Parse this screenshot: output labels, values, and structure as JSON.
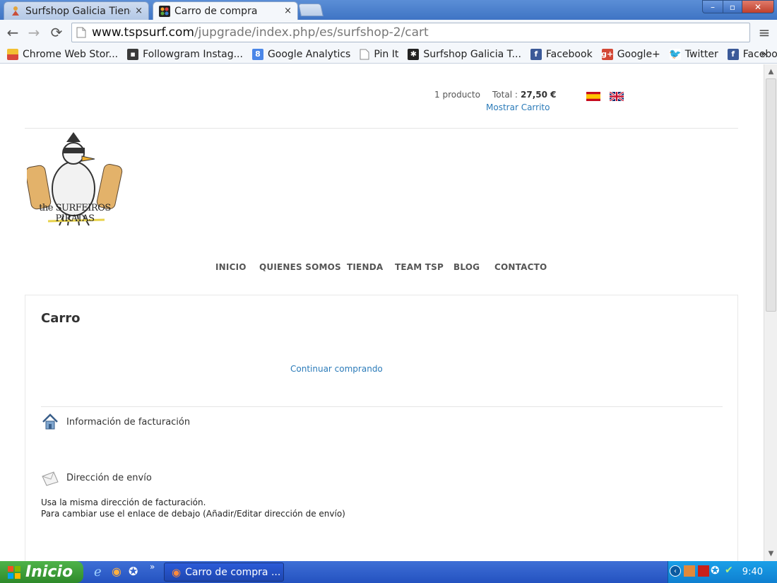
{
  "browser": {
    "tabs": [
      {
        "label": "Surfshop Galicia Tienda",
        "close": "×",
        "active": false
      },
      {
        "label": "Carro de compra",
        "close": "×",
        "active": true
      }
    ],
    "window_controls": {
      "minimize": "–",
      "maximize": "▫",
      "close": "✕"
    },
    "url_host": "www.tspsurf.com",
    "url_path": "/jupgrade/index.php/es/surfshop-2/cart",
    "bookmarks": [
      {
        "label": "Chrome Web Stor...",
        "icon": "chrome-store-icon"
      },
      {
        "label": "Followgram Instag...",
        "icon": "followgram-icon"
      },
      {
        "label": "Google Analytics",
        "icon": "google-analytics-icon"
      },
      {
        "label": "Pin It",
        "icon": "page-icon"
      },
      {
        "label": "Surfshop Galicia T...",
        "icon": "joomla-icon"
      },
      {
        "label": "Facebook",
        "icon": "facebook-icon"
      },
      {
        "label": "Google+",
        "icon": "googleplus-icon"
      },
      {
        "label": "Twitter",
        "icon": "twitter-icon"
      },
      {
        "label": "Facebook",
        "icon": "facebook-icon"
      }
    ],
    "bookmarks_overflow": "»"
  },
  "page": {
    "cart": {
      "products": "1 producto",
      "total_label": "Total :",
      "total_value": "27,50 €",
      "show_cart": "Mostrar Carrito"
    },
    "logo_text": "the SURFEIROS PIRATAS",
    "menu": [
      "INICIO",
      "QUIENES SOMOS",
      "TIENDA",
      "TEAM TSP",
      "BLOG",
      "CONTACTO"
    ],
    "heading": "Carro",
    "continue_shopping": "Continuar comprando",
    "billing_title": "Información de facturación",
    "shipping_title": "Dirección de envío",
    "shipping_note_1": "Usa la misma dirección de facturación.",
    "shipping_note_2": "Para cambiar use el enlace de debajo (Añadir/Editar dirección de envío)"
  },
  "taskbar": {
    "start_label": "Inicio",
    "window_label": "Carro de compra ...",
    "quick_overflow": "»",
    "clock": "9:40"
  },
  "colors": {
    "link": "#2b7bb9",
    "menu_text": "#555555",
    "taskbar": "#2452c0",
    "start": "#2e8a2a"
  }
}
